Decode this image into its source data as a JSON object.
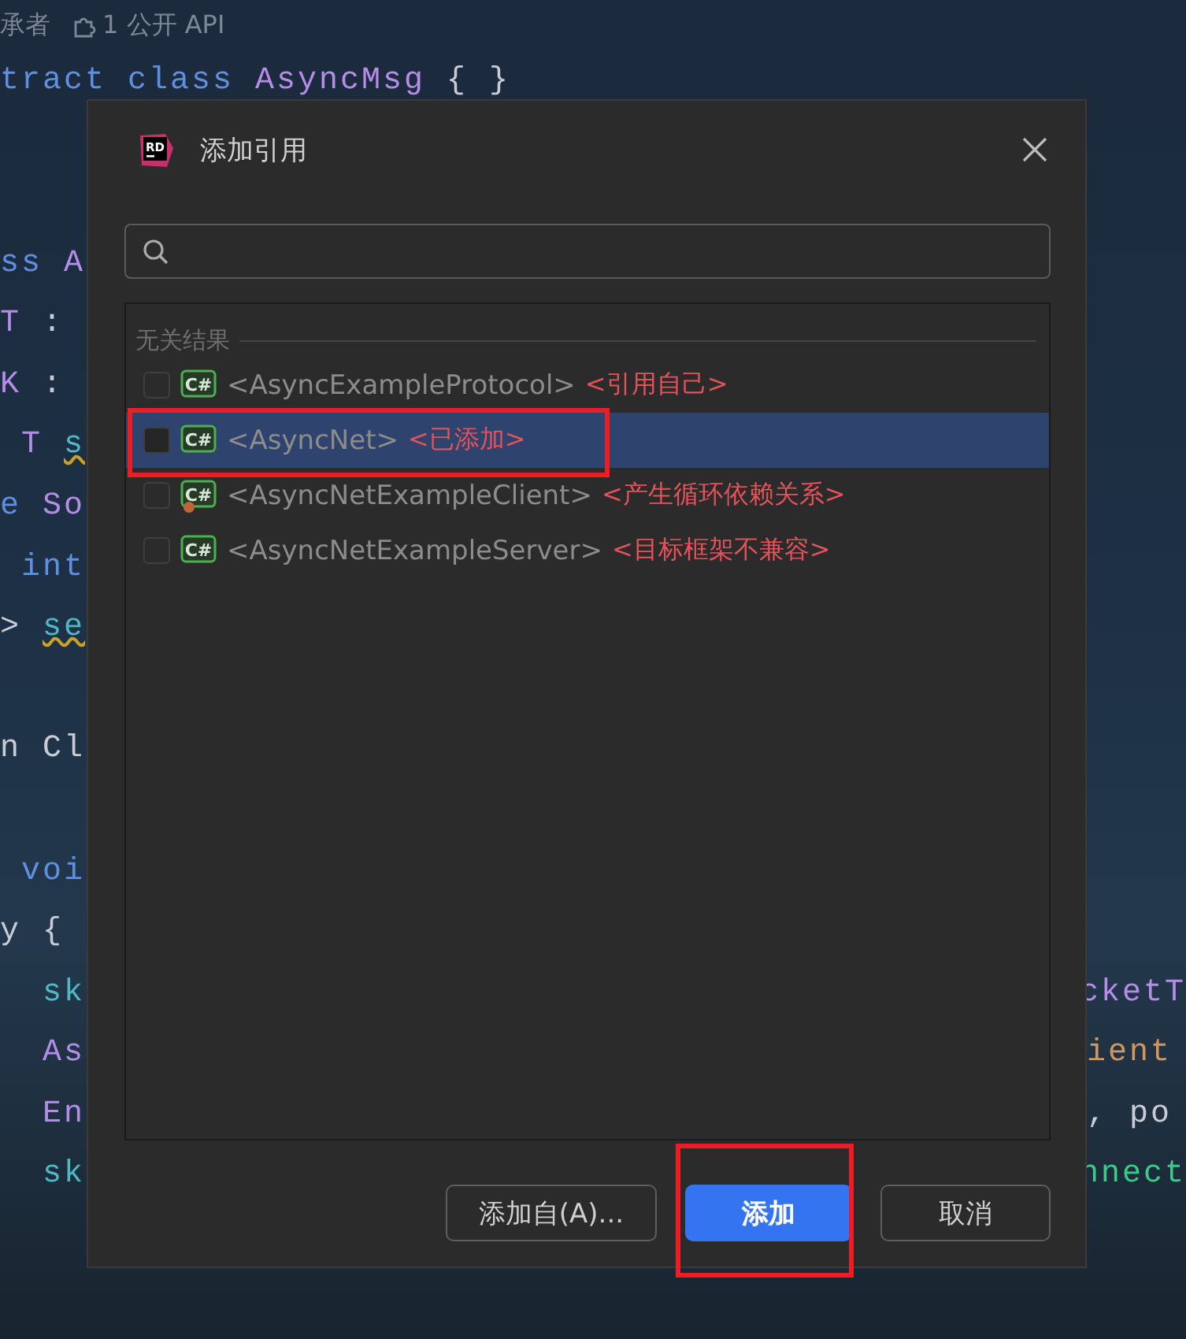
{
  "editor": {
    "hints": [
      {
        "kind": "text",
        "text": "承者"
      },
      {
        "kind": "api",
        "text": "1 公开 API"
      }
    ],
    "lines": [
      {
        "kind": "code",
        "left": [
          {
            "kind": "keyword",
            "text": "tract class "
          },
          {
            "kind": "type",
            "text": "AsyncMsg"
          },
          {
            "kind": "plain",
            "text": " { }"
          }
        ]
      },
      {
        "kind": "blank"
      },
      {
        "kind": "blank"
      },
      {
        "kind": "code",
        "left": [
          {
            "kind": "keyword",
            "text": "ss "
          },
          {
            "kind": "type",
            "text": "A"
          }
        ]
      },
      {
        "kind": "code",
        "left": [
          {
            "kind": "type",
            "text": "T"
          },
          {
            "kind": "plain",
            "text": " :"
          }
        ]
      },
      {
        "kind": "code",
        "left": [
          {
            "kind": "type",
            "text": "K"
          },
          {
            "kind": "plain",
            "text": " :"
          }
        ]
      },
      {
        "kind": "code",
        "left": [
          {
            "kind": "type",
            "text": " T "
          },
          {
            "kind": "warning",
            "text": "s"
          }
        ]
      },
      {
        "kind": "code",
        "left": [
          {
            "kind": "keyword",
            "text": "e "
          },
          {
            "kind": "type",
            "text": "So"
          }
        ]
      },
      {
        "kind": "code",
        "left": [
          {
            "kind": "keyword",
            "text": " int"
          }
        ]
      },
      {
        "kind": "code",
        "left": [
          {
            "kind": "plain",
            "text": "> "
          },
          {
            "kind": "warning",
            "text": "se"
          }
        ]
      },
      {
        "kind": "blank"
      },
      {
        "kind": "code",
        "left": [
          {
            "kind": "plain",
            "text": "n Cl"
          }
        ]
      },
      {
        "kind": "blank"
      },
      {
        "kind": "code",
        "left": [
          {
            "kind": "keyword",
            "text": " voi"
          }
        ]
      },
      {
        "kind": "code",
        "left": [
          {
            "kind": "plain",
            "text": "y {"
          }
        ]
      },
      {
        "kind": "code",
        "left": [
          {
            "kind": "ident",
            "text": "  sk"
          }
        ],
        "right": [
          {
            "kind": "type",
            "text": "cketT"
          }
        ]
      },
      {
        "kind": "code",
        "left": [
          {
            "kind": "type",
            "text": "  As"
          }
        ],
        "right": [
          {
            "kind": "string",
            "text": "ient"
          }
        ]
      },
      {
        "kind": "code",
        "left": [
          {
            "kind": "type",
            "text": "  En"
          }
        ],
        "right": [
          {
            "kind": "plain",
            "text": ", po"
          }
        ]
      },
      {
        "kind": "code",
        "left": [
          {
            "kind": "ident",
            "text": "  sk"
          }
        ],
        "right": [
          {
            "kind": "method",
            "text": "nnect"
          }
        ]
      }
    ]
  },
  "dialog": {
    "logo_text": "RD",
    "title": "添加引用",
    "group": "无关结果",
    "items": [
      {
        "badge": "C#",
        "name": "<AsyncExampleProtocol>",
        "reason": "<引用自己>",
        "checked": false,
        "selected": false,
        "highlighted": false,
        "kind": "project"
      },
      {
        "badge": "C#",
        "name": "<AsyncNet>",
        "reason": "<已添加>",
        "checked": false,
        "selected": true,
        "highlighted": true,
        "kind": "project"
      },
      {
        "badge": "C#",
        "name": "<AsyncNetExampleClient>",
        "reason": "<产生循环依赖关系>",
        "checked": false,
        "selected": false,
        "highlighted": false,
        "kind": "project_cycle"
      },
      {
        "badge": "C#",
        "name": "<AsyncNetExampleServer>",
        "reason": "<目标框架不兼容>",
        "checked": false,
        "selected": false,
        "highlighted": false,
        "kind": "project"
      }
    ],
    "buttons": [
      {
        "label": "添加自(A)...",
        "kind": "secondary",
        "highlighted": false
      },
      {
        "label": "添加",
        "kind": "primary",
        "highlighted": true
      },
      {
        "label": "取消",
        "kind": "secondary",
        "highlighted": false
      }
    ]
  }
}
